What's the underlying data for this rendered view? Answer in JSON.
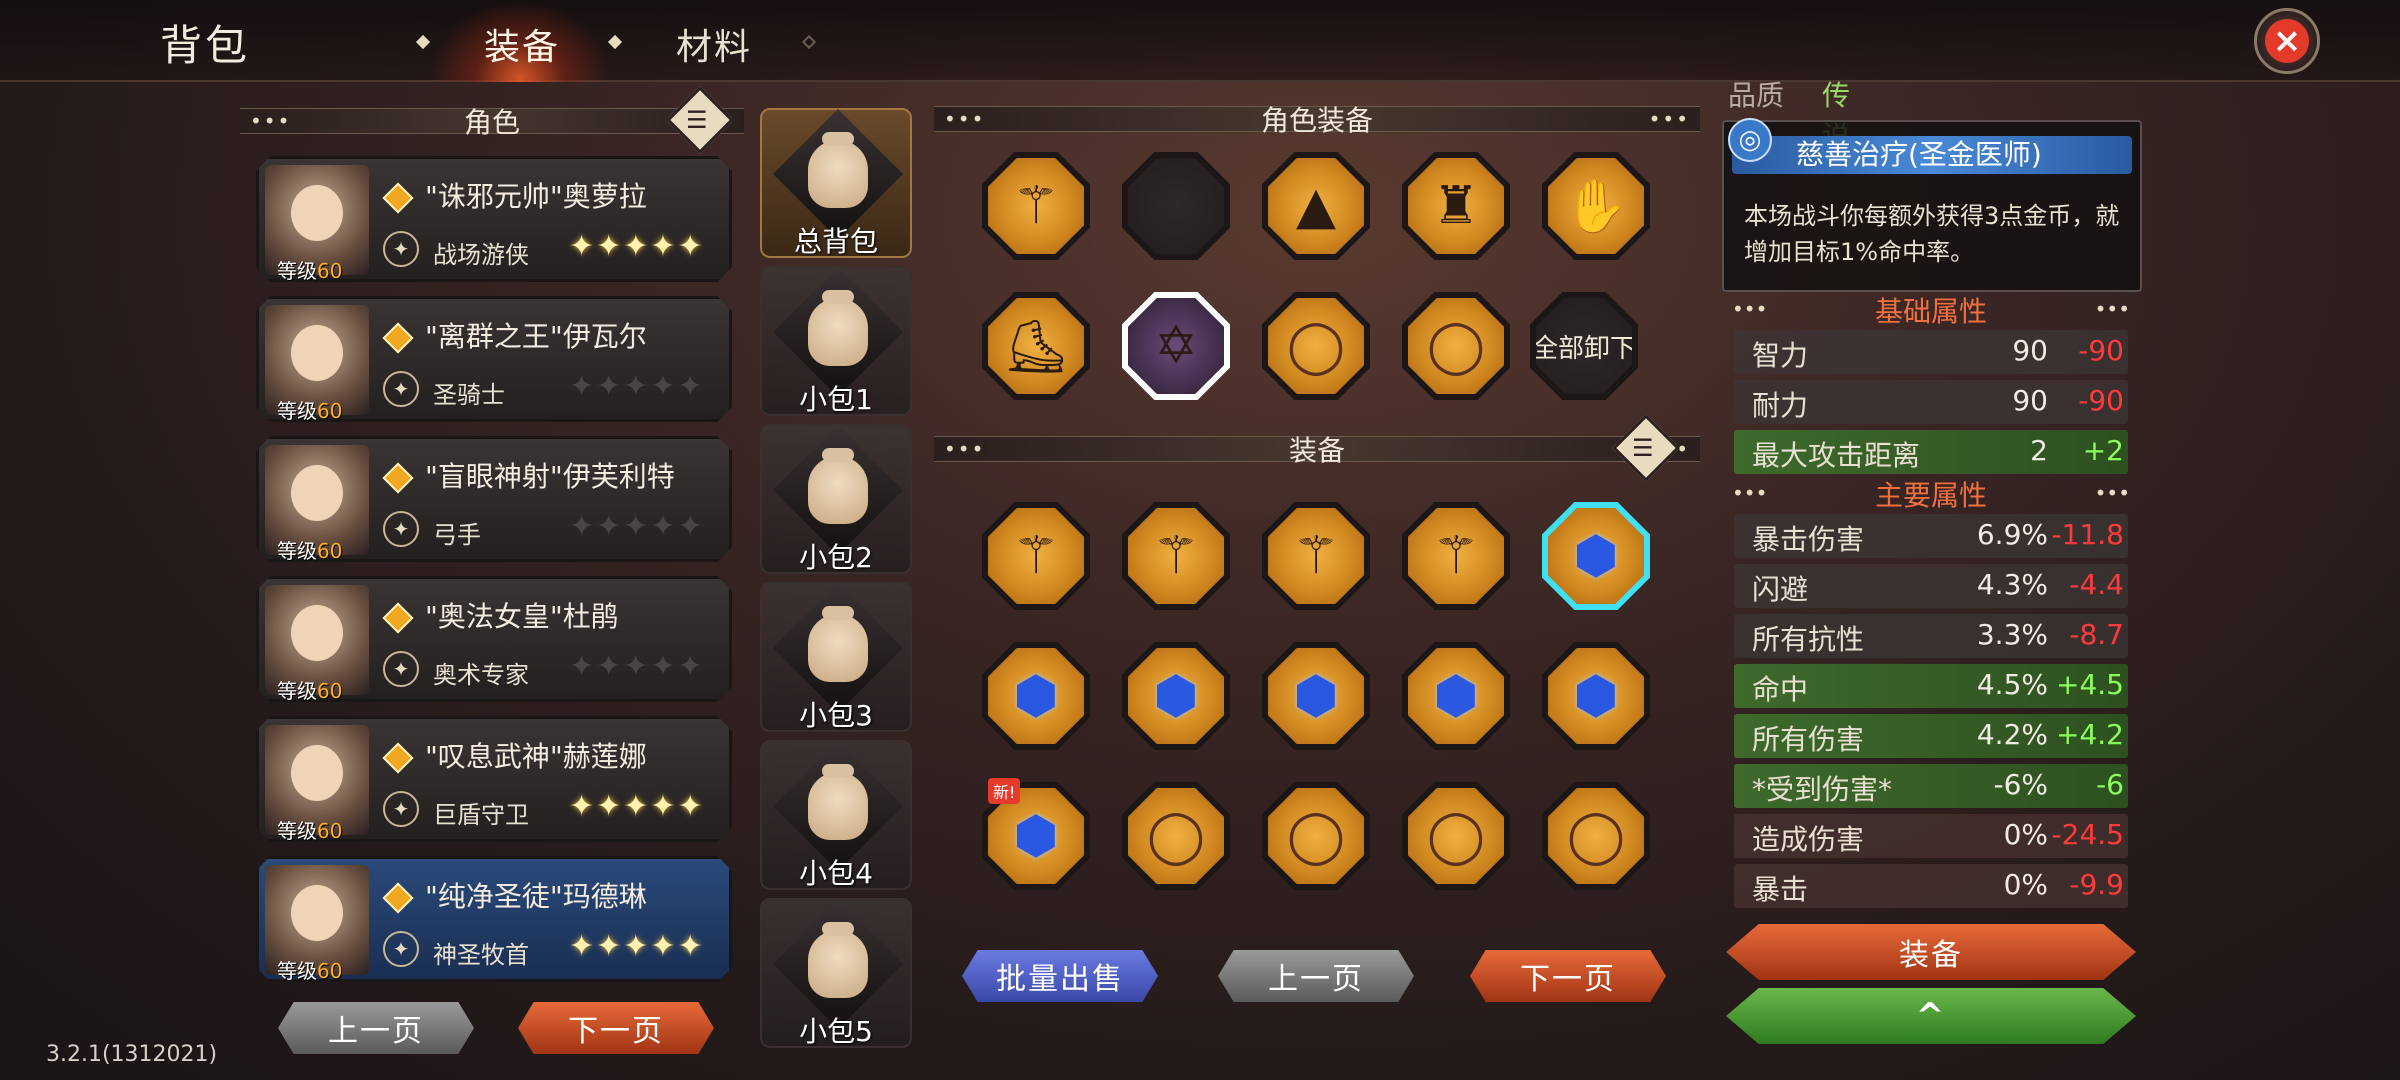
{
  "header": {
    "title": "背包",
    "tabs": [
      {
        "label": "装备",
        "active": true
      },
      {
        "label": "材料",
        "active": false
      }
    ]
  },
  "left": {
    "section_title": "角色",
    "characters": [
      {
        "name": "\"诛邪元帅\"奥萝拉",
        "class": "战场游侠",
        "level_label": "等级",
        "level": "60",
        "stars": 5
      },
      {
        "name": "\"离群之王\"伊瓦尔",
        "class": "圣骑士",
        "level_label": "等级",
        "level": "60",
        "stars": 0
      },
      {
        "name": "\"盲眼神射\"伊芙利特",
        "class": "弓手",
        "level_label": "等级",
        "level": "60",
        "stars": 0
      },
      {
        "name": "\"奥法女皇\"杜鹃",
        "class": "奥术专家",
        "level_label": "等级",
        "level": "60",
        "stars": 0
      },
      {
        "name": "\"叹息武神\"赫莲娜",
        "class": "巨盾守卫",
        "level_label": "等级",
        "level": "60",
        "stars": 5
      },
      {
        "name": "\"纯净圣徒\"玛德琳",
        "class": "神圣牧首",
        "level_label": "等级",
        "level": "60",
        "stars": 5,
        "selected": true
      }
    ],
    "prev_label": "上一页",
    "next_label": "下一页"
  },
  "bags": [
    {
      "label": "总背包",
      "active": true
    },
    {
      "label": "小包1"
    },
    {
      "label": "小包2"
    },
    {
      "label": "小包3"
    },
    {
      "label": "小包4"
    },
    {
      "label": "小包5"
    }
  ],
  "center": {
    "equipped_title": "角色装备",
    "unequip_all_label": "全部卸下",
    "equipped_slots": [
      {
        "icon": "staff-icon"
      },
      {
        "icon": "empty-slot"
      },
      {
        "icon": "hood-icon"
      },
      {
        "icon": "cloak-icon"
      },
      {
        "icon": "gloves-icon"
      },
      {
        "icon": "boots-icon"
      },
      {
        "icon": "hexagram-icon"
      },
      {
        "icon": "ring-icon"
      },
      {
        "icon": "ring-icon"
      }
    ],
    "inventory_title": "装备",
    "inventory_slots": [
      {
        "icon": "staff-icon"
      },
      {
        "icon": "staff-icon"
      },
      {
        "icon": "staff-icon"
      },
      {
        "icon": "staff-icon"
      },
      {
        "icon": "amulet-icon",
        "selected": true
      },
      {
        "icon": "amulet-icon"
      },
      {
        "icon": "amulet-icon"
      },
      {
        "icon": "amulet-icon"
      },
      {
        "icon": "amulet-icon"
      },
      {
        "icon": "amulet-icon"
      },
      {
        "icon": "amulet-icon",
        "new": "新!"
      },
      {
        "icon": "ring-icon"
      },
      {
        "icon": "ring-icon"
      },
      {
        "icon": "ring-icon"
      },
      {
        "icon": "ring-icon"
      }
    ],
    "bulk_sell_label": "批量出售",
    "prev_label": "上一页",
    "next_label": "下一页"
  },
  "right": {
    "quality_label": "品质",
    "quality_value": "传说",
    "skill_name": "慈善治疗(圣金医师)",
    "skill_desc": "本场战斗你每额外获得3点金币，就增加目标1%命中率。",
    "base_title": "基础属性",
    "base_stats": [
      {
        "name": "智力",
        "value": "90",
        "delta": "-90",
        "type": "neg",
        "style": "plain"
      },
      {
        "name": "耐力",
        "value": "90",
        "delta": "-90",
        "type": "neg",
        "style": "plain"
      },
      {
        "name": "最大攻击距离",
        "value": "2",
        "delta": "+2",
        "type": "pos",
        "style": "green"
      }
    ],
    "main_title": "主要属性",
    "main_stats": [
      {
        "name": "暴击伤害",
        "value": "6.9%",
        "delta": "-11.8",
        "type": "neg",
        "style": "plain"
      },
      {
        "name": "闪避",
        "value": "4.3%",
        "delta": "-4.4",
        "type": "neg",
        "style": "plain"
      },
      {
        "name": "所有抗性",
        "value": "3.3%",
        "delta": "-8.7",
        "type": "neg",
        "style": "plain"
      },
      {
        "name": "命中",
        "value": "4.5%",
        "delta": "+4.5",
        "type": "pos",
        "style": "green"
      },
      {
        "name": "所有伤害",
        "value": "4.2%",
        "delta": "+4.2",
        "type": "pos",
        "style": "green"
      },
      {
        "name": "*受到伤害*",
        "value": "-6%",
        "delta": "-6",
        "type": "pos",
        "style": "green"
      },
      {
        "name": "造成伤害",
        "value": "0%",
        "delta": "-24.5",
        "type": "neg",
        "style": "red"
      },
      {
        "name": "暴击",
        "value": "0%",
        "delta": "-9.9",
        "type": "neg",
        "style": "red"
      }
    ],
    "equip_label": "装备",
    "collapse_label": "^"
  },
  "version": "3.2.1(1312021)",
  "colors": {
    "accent_orange": "#e86a3a",
    "selected_blue": "#3a8ce0",
    "positive": "#8aff5a",
    "negative": "#ff3a3a"
  }
}
